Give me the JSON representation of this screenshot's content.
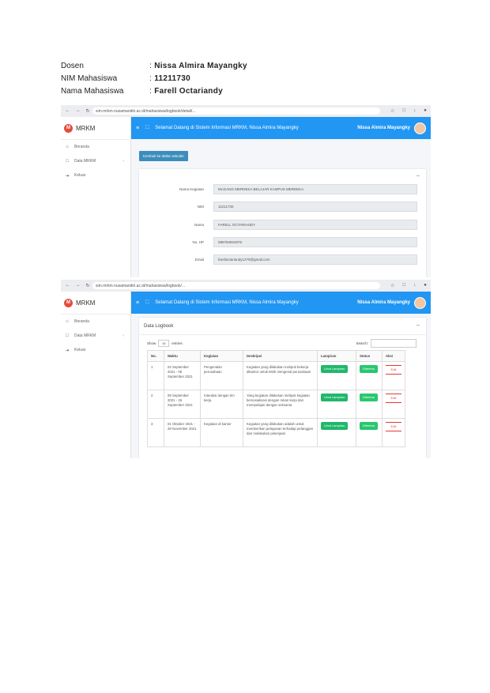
{
  "header": {
    "rows": [
      {
        "key": "Dosen",
        "value": "Nissa Almira Mayangky"
      },
      {
        "key": "NIM Mahasiswa",
        "value": "11211730"
      },
      {
        "key": "Nama Mahasiswa",
        "value": "Farell Octariandy"
      }
    ],
    "separator": ":"
  },
  "browser": {
    "url1": "sim.mrkm.nusamandiri.ac.id/mahasiswa/logbook/detail/...",
    "url2": "sim.mrkm.nusamandiri.ac.id/mahasiswa/logbook/...",
    "nav_icons": [
      "←",
      "→",
      "↻"
    ],
    "ext_icons": [
      "☆",
      "□",
      "↓",
      "●"
    ]
  },
  "app": {
    "brand": "MRKM",
    "brand_logo": "M",
    "sidebar": [
      {
        "icon": "⌂",
        "label": "Beranda",
        "chev": ""
      },
      {
        "icon": "□",
        "label": "Data MRKM",
        "chev": "‹"
      },
      {
        "icon": "⇥",
        "label": "Keluar",
        "chev": ""
      }
    ],
    "topbar_title": "Selamat Datang di Sistem Informasi MRKM, Nissa Almira Mayangky",
    "topbar_user": "Nissa Almira Mayangky",
    "hamburger": "≡",
    "expand": "⛶"
  },
  "detail": {
    "back_button": "Kembali ke daftar sekolah",
    "collapse": "–",
    "fields": [
      {
        "label": "Nama Kegiatan",
        "value": "MAGANG MERDEKA BELAJAR KAMPUS MERDEKA"
      },
      {
        "label": "NIM",
        "value": "11211730"
      },
      {
        "label": "Nama",
        "value": "FARELL OCTARIANDY"
      },
      {
        "label": "No. HP",
        "value": "085784924875"
      },
      {
        "label": "Email",
        "value": "farelloctariandy1279@gmail.com"
      }
    ]
  },
  "logbook": {
    "title": "Data Logbook",
    "collapse": "–",
    "show_label": "Show",
    "show_value": "10",
    "entries_label": "entries",
    "search_label": "Search:",
    "columns": [
      "No.",
      "Waktu",
      "Kegiatan",
      "Deskripsi",
      "Lampiran",
      "Status",
      "Aksi"
    ],
    "rows": [
      {
        "no": "1",
        "waktu": "02 September 2021 - 05 September 2021",
        "kegiatan": "Pengenalan perusahaan",
        "deskripsi": "Kegiatan yang dilakukan meliputi bekerja dikantor untuk lebih mengenal perusahaan",
        "lampiran": "Lihat Lampiran",
        "status": "Diterima",
        "aksi": "Edit"
      },
      {
        "no": "2",
        "waktu": "09 September 2021 - 26 September 2021",
        "kegiatan": "Interaksi dengan tim kerja",
        "deskripsi": "Yang kegiatan dilakukan meliputi kegiatan bersosialisasi dengan rekan kerja dan mempelajari dengan seksama",
        "lampiran": "Lihat Lampiran",
        "status": "Diterima",
        "aksi": "Edit"
      },
      {
        "no": "3",
        "waktu": "01 Oktober 2021 - 28 November 2021",
        "kegiatan": "Kegiatan di kantor",
        "deskripsi": "Kegiatan yang dilakukan adalah untuk memberikan pelayanan terhadap pelanggan dan melakukan pekerjaan",
        "lampiran": "Lihat Lampiran",
        "status": "Diterima",
        "aksi": "Edit"
      }
    ]
  }
}
